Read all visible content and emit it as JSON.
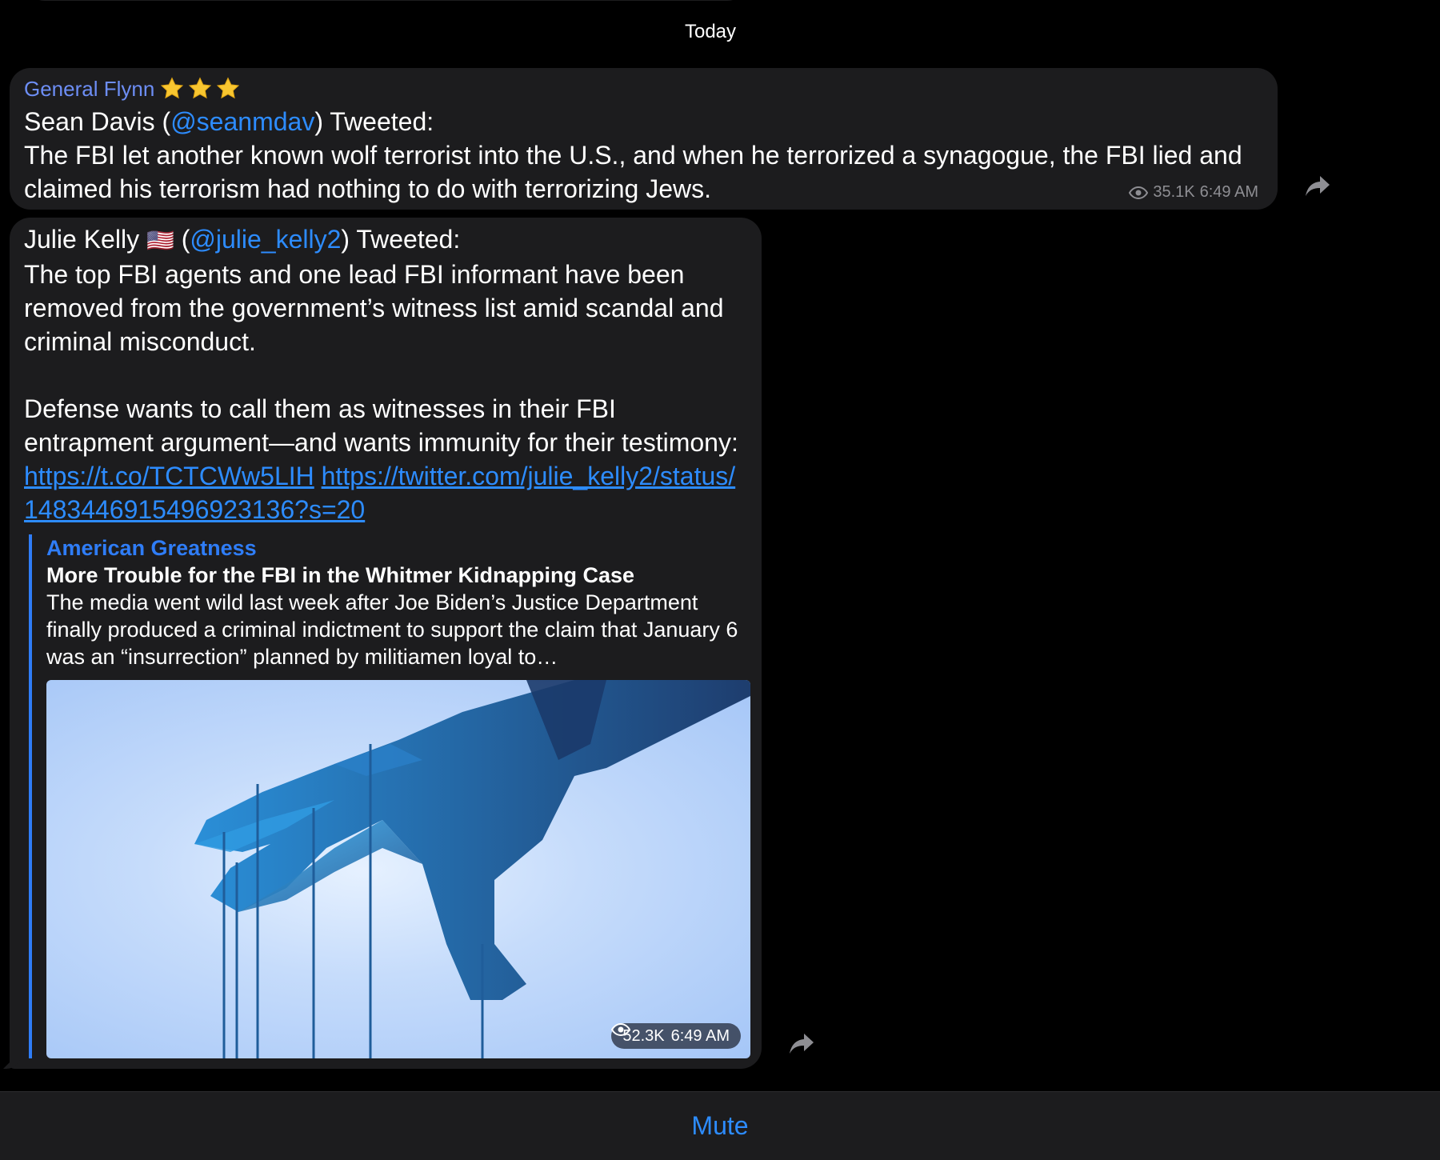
{
  "date_separator": "Today",
  "messages": [
    {
      "sender": "General Flynn",
      "sender_emoji": [
        "star",
        "star",
        "star"
      ],
      "author": "Sean Davis",
      "handle": "@seanmdav",
      "tweeted": "Tweeted:",
      "text": "The FBI let another known wolf terrorist into the U.S., and when he terrorized a synagogue, the FBI lied and claimed his terrorism had nothing to do with terrorizing Jews.",
      "views": "35.1K",
      "time": "6:49 AM"
    },
    {
      "author": "Julie Kelly",
      "author_flag": "🇺🇸",
      "handle": "@julie_kelly2",
      "tweeted": "Tweeted:",
      "paragraph1": "The top FBI agents and one lead FBI informant have been removed from the government’s witness list amid scandal and criminal misconduct.",
      "paragraph2": "Defense wants to call them as witnesses in their FBI entrapment argument—and wants immunity for their testimony:",
      "link1": "https://t.co/TCTCWw5LIH",
      "link2": "https://twitter.com/julie_kelly2/status/1483446915496923136?s=20",
      "preview": {
        "site": "American Greatness",
        "title": "More Trouble for the FBI in the Whitmer Kidnapping Case",
        "description": "The media went wild last week after Joe Biden’s Justice Department finally produced a criminal indictment to support the claim that January 6 was an “insurrection” planned by militiamen loyal to…"
      },
      "views": "52.3K",
      "time": "6:49 AM"
    }
  ],
  "bottom_bar": {
    "mute_label": "Mute"
  },
  "icons": {
    "views": "eye-icon",
    "share": "share-arrow-icon",
    "sender_badge": "star-icon"
  },
  "colors": {
    "background": "#000000",
    "bubble": "#1c1c1e",
    "accent": "#2d8cff",
    "sender": "#6d8ef5",
    "meta": "#8e8e93"
  }
}
